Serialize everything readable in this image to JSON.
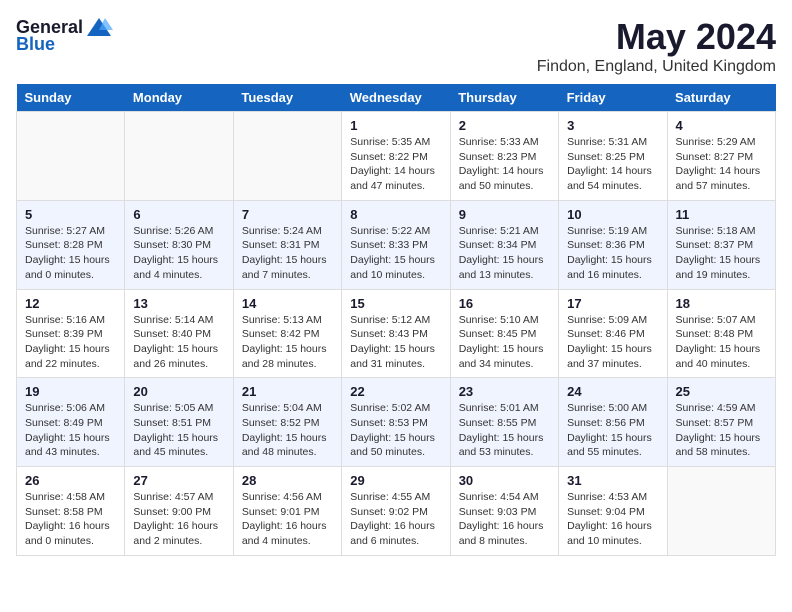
{
  "logo": {
    "general": "General",
    "blue": "Blue"
  },
  "title": "May 2024",
  "subtitle": "Findon, England, United Kingdom",
  "days_header": [
    "Sunday",
    "Monday",
    "Tuesday",
    "Wednesday",
    "Thursday",
    "Friday",
    "Saturday"
  ],
  "weeks": [
    [
      {
        "day": "",
        "info": ""
      },
      {
        "day": "",
        "info": ""
      },
      {
        "day": "",
        "info": ""
      },
      {
        "day": "1",
        "info": "Sunrise: 5:35 AM\nSunset: 8:22 PM\nDaylight: 14 hours\nand 47 minutes."
      },
      {
        "day": "2",
        "info": "Sunrise: 5:33 AM\nSunset: 8:23 PM\nDaylight: 14 hours\nand 50 minutes."
      },
      {
        "day": "3",
        "info": "Sunrise: 5:31 AM\nSunset: 8:25 PM\nDaylight: 14 hours\nand 54 minutes."
      },
      {
        "day": "4",
        "info": "Sunrise: 5:29 AM\nSunset: 8:27 PM\nDaylight: 14 hours\nand 57 minutes."
      }
    ],
    [
      {
        "day": "5",
        "info": "Sunrise: 5:27 AM\nSunset: 8:28 PM\nDaylight: 15 hours\nand 0 minutes."
      },
      {
        "day": "6",
        "info": "Sunrise: 5:26 AM\nSunset: 8:30 PM\nDaylight: 15 hours\nand 4 minutes."
      },
      {
        "day": "7",
        "info": "Sunrise: 5:24 AM\nSunset: 8:31 PM\nDaylight: 15 hours\nand 7 minutes."
      },
      {
        "day": "8",
        "info": "Sunrise: 5:22 AM\nSunset: 8:33 PM\nDaylight: 15 hours\nand 10 minutes."
      },
      {
        "day": "9",
        "info": "Sunrise: 5:21 AM\nSunset: 8:34 PM\nDaylight: 15 hours\nand 13 minutes."
      },
      {
        "day": "10",
        "info": "Sunrise: 5:19 AM\nSunset: 8:36 PM\nDaylight: 15 hours\nand 16 minutes."
      },
      {
        "day": "11",
        "info": "Sunrise: 5:18 AM\nSunset: 8:37 PM\nDaylight: 15 hours\nand 19 minutes."
      }
    ],
    [
      {
        "day": "12",
        "info": "Sunrise: 5:16 AM\nSunset: 8:39 PM\nDaylight: 15 hours\nand 22 minutes."
      },
      {
        "day": "13",
        "info": "Sunrise: 5:14 AM\nSunset: 8:40 PM\nDaylight: 15 hours\nand 26 minutes."
      },
      {
        "day": "14",
        "info": "Sunrise: 5:13 AM\nSunset: 8:42 PM\nDaylight: 15 hours\nand 28 minutes."
      },
      {
        "day": "15",
        "info": "Sunrise: 5:12 AM\nSunset: 8:43 PM\nDaylight: 15 hours\nand 31 minutes."
      },
      {
        "day": "16",
        "info": "Sunrise: 5:10 AM\nSunset: 8:45 PM\nDaylight: 15 hours\nand 34 minutes."
      },
      {
        "day": "17",
        "info": "Sunrise: 5:09 AM\nSunset: 8:46 PM\nDaylight: 15 hours\nand 37 minutes."
      },
      {
        "day": "18",
        "info": "Sunrise: 5:07 AM\nSunset: 8:48 PM\nDaylight: 15 hours\nand 40 minutes."
      }
    ],
    [
      {
        "day": "19",
        "info": "Sunrise: 5:06 AM\nSunset: 8:49 PM\nDaylight: 15 hours\nand 43 minutes."
      },
      {
        "day": "20",
        "info": "Sunrise: 5:05 AM\nSunset: 8:51 PM\nDaylight: 15 hours\nand 45 minutes."
      },
      {
        "day": "21",
        "info": "Sunrise: 5:04 AM\nSunset: 8:52 PM\nDaylight: 15 hours\nand 48 minutes."
      },
      {
        "day": "22",
        "info": "Sunrise: 5:02 AM\nSunset: 8:53 PM\nDaylight: 15 hours\nand 50 minutes."
      },
      {
        "day": "23",
        "info": "Sunrise: 5:01 AM\nSunset: 8:55 PM\nDaylight: 15 hours\nand 53 minutes."
      },
      {
        "day": "24",
        "info": "Sunrise: 5:00 AM\nSunset: 8:56 PM\nDaylight: 15 hours\nand 55 minutes."
      },
      {
        "day": "25",
        "info": "Sunrise: 4:59 AM\nSunset: 8:57 PM\nDaylight: 15 hours\nand 58 minutes."
      }
    ],
    [
      {
        "day": "26",
        "info": "Sunrise: 4:58 AM\nSunset: 8:58 PM\nDaylight: 16 hours\nand 0 minutes."
      },
      {
        "day": "27",
        "info": "Sunrise: 4:57 AM\nSunset: 9:00 PM\nDaylight: 16 hours\nand 2 minutes."
      },
      {
        "day": "28",
        "info": "Sunrise: 4:56 AM\nSunset: 9:01 PM\nDaylight: 16 hours\nand 4 minutes."
      },
      {
        "day": "29",
        "info": "Sunrise: 4:55 AM\nSunset: 9:02 PM\nDaylight: 16 hours\nand 6 minutes."
      },
      {
        "day": "30",
        "info": "Sunrise: 4:54 AM\nSunset: 9:03 PM\nDaylight: 16 hours\nand 8 minutes."
      },
      {
        "day": "31",
        "info": "Sunrise: 4:53 AM\nSunset: 9:04 PM\nDaylight: 16 hours\nand 10 minutes."
      },
      {
        "day": "",
        "info": ""
      }
    ]
  ]
}
